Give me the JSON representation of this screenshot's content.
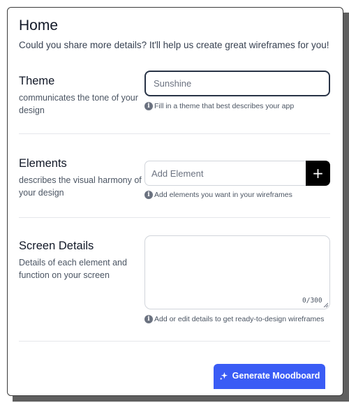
{
  "header": {
    "title": "Home",
    "subtitle": "Could you share more details? It'll help us create great wireframes for you!"
  },
  "theme": {
    "label": "Theme",
    "description": "communicates the tone of your design",
    "value": "",
    "placeholder": "Sunshine",
    "hint": "Fill in a theme that best describes your app"
  },
  "elements": {
    "label": "Elements",
    "description": "describes the visual harmony of your design",
    "placeholder": "Add Element",
    "add_button": "+",
    "hint": "Add elements you want in your wireframes"
  },
  "screen_details": {
    "label": "Screen Details",
    "description": "Details of each element and function on your screen",
    "value": "",
    "counter": "0/300",
    "hint": "Add or edit details to get ready-to-design wireframes"
  },
  "actions": {
    "generate_label": "Generate Moodboard"
  },
  "icons": {
    "info": "info-icon",
    "sparkle": "sparkle-icon",
    "plus": "plus-icon"
  },
  "colors": {
    "primary_button": "#3a5cf5",
    "add_button": "#000000",
    "focused_border": "#283346"
  }
}
